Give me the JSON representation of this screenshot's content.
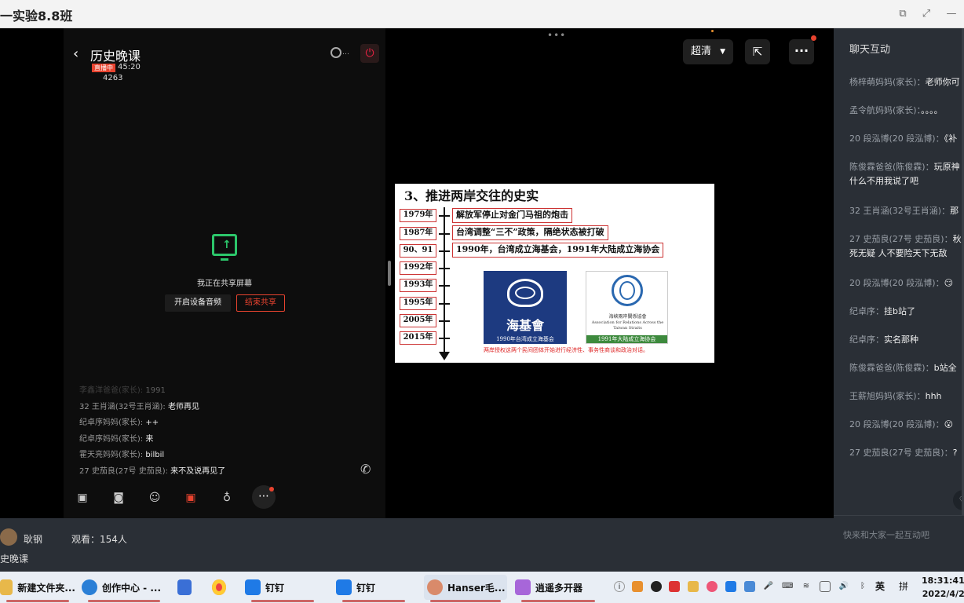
{
  "window": {
    "title": "一实验8.8班"
  },
  "phone": {
    "title": "历史晚课",
    "live_badge": "直播中",
    "live_time": "45:20",
    "live_count": "4263",
    "share_text": "我正在共享屏幕",
    "audio_button": "开启设备音频",
    "stop_button": "结束共享",
    "chat": [
      {
        "user": "李鑫洋爸爸(家长):",
        "text": "1991"
      },
      {
        "user": "32 王肖涵(32号王肖涵):",
        "text": "老师再见"
      },
      {
        "user": "纪卓序妈妈(家长):",
        "text": "++"
      },
      {
        "user": "纪卓序妈妈(家长):",
        "text": "来"
      },
      {
        "user": "霍天亮妈妈(家长):",
        "text": "bilbil"
      },
      {
        "user": "27 史茄良(27号 史茄良):",
        "text": "来不及说再见了"
      }
    ]
  },
  "controls": {
    "quality": "超清"
  },
  "slide": {
    "title": "3、推进两岸交往的史实",
    "years": [
      "1979年",
      "1987年",
      "90、91",
      "1992年",
      "1993年",
      "1995年",
      "2005年",
      "2015年"
    ],
    "events": [
      "解放军停止对金门马祖的炮击",
      "台湾调整“三不”政策，隔绝状态被打破",
      "1990年，台湾成立海基会，1991年大陆成立海协会"
    ],
    "logo1_name": "海基會",
    "logo1_caption": "1990年台湾成立海基会",
    "logo2_cn": "海峽兩岸關係協會",
    "logo2_en": "Association for Relations Across the Taiwan Straits",
    "logo2_caption": "1991年大陆成立海协会",
    "note": "两岸授权这两个民间团体开始进行经济性、事务性商谈和政治对话。"
  },
  "info": {
    "host": "耿钢",
    "viewers": "观看：154人",
    "course": "史晚课"
  },
  "chatpanel": {
    "title": "聊天互动",
    "messages": [
      {
        "user": "杨梓萌妈妈(家长)：",
        "text": "老师你可"
      },
      {
        "user": "孟令航妈妈(家长)：",
        "text": "。。。。"
      },
      {
        "user": "20 段泓博(20 段泓博)：",
        "text": "《补"
      },
      {
        "user": "陈俊霖爸爸(陈俊霖)：",
        "text": "玩原神什么不用我说了吧"
      },
      {
        "user": "32 王肖涵(32号王肖涵)：",
        "text": "那"
      },
      {
        "user": "27 史茄良(27号 史茄良)：",
        "text": "秋死无疑 人不要险天下无敌"
      },
      {
        "user": "20 段泓博(20 段泓博)：",
        "text": "😏"
      },
      {
        "user": "纪卓序：",
        "text": "挂b站了"
      },
      {
        "user": "纪卓序：",
        "text": "实名那种"
      },
      {
        "user": "陈俊霖爸爸(陈俊霖)：",
        "text": "b站全"
      },
      {
        "user": "王薪旭妈妈(家长)：",
        "text": "hhh"
      },
      {
        "user": "20 段泓博(20 段泓博)：",
        "text": "😮"
      },
      {
        "user": "27 史茄良(27号 史茄良)：",
        "text": "?"
      }
    ],
    "input_placeholder": "快来和大家一起互动吧"
  },
  "taskbar": {
    "items": [
      "新建文件夹...",
      "创作中心 - ...",
      "钉钉",
      "钉钉",
      "Hanser毛...",
      "逍遥多开器"
    ],
    "ime": "英",
    "ime2": "拼",
    "time": "18:31:41",
    "date": "2022/4/2"
  }
}
